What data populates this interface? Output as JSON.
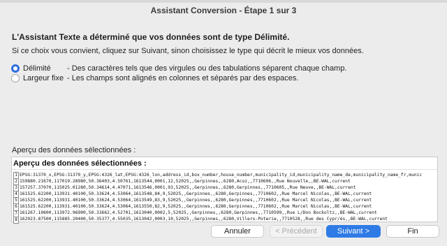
{
  "window": {
    "title": "Assistant Conversion - Étape 1 sur 3"
  },
  "main": {
    "heading": "L'Assistant Texte a déterminé que vos données sont de type Délimité.",
    "description": "Si ce choix vous convient, cliquez sur Suivant, sinon choisissez le type qui décrit le mieux vos données.",
    "options": [
      {
        "label": "Délimité",
        "description": "- Des caractères tels que des virgules ou des tabulations séparent chaque champ.",
        "selected": true
      },
      {
        "label": "Largeur fixe",
        "description": "- Les champs sont alignés en colonnes et séparés par des espaces.",
        "selected": false
      }
    ]
  },
  "preview": {
    "caption": "Aperçu des données sélectionnées :",
    "header": "Aperçu des données sélectionnées :",
    "rows": [
      {
        "num": "1",
        "text": "EPSG:31370_x,EPSG:31370_y,EPSG:4326_lat,EPSG:4326_lon,address_id,box_number,house_number,municipality_id,municipality_name_de,municipality_name_fr,munic"
      },
      {
        "num": "2",
        "text": "159880.21670,117019.28980,50.36403,4.50761,1613544,0001,12,52025,,Gerpinnes,,6280,Acoz,,7710606,,Rue Nouvelle,,BE-WAL,current"
      },
      {
        "num": "3",
        "text": "157257.37070,115025.01280,50.34614,4.47071,1613546,0001,93,52025,,Gerpinnes,,6280,Gerpinnes,,7710605,,Rue Neuve,,BE-WAL,current"
      },
      {
        "num": "4",
        "text": "161525.62200,113931.40100,50.33624,4.53064,1613548,84,9,52025,,Gerpinnes,,6280,Gerpinnes,,7710602,,Rue Marcel Nicolas,,BE-WAL,current"
      },
      {
        "num": "5",
        "text": "161525.62200,113931.40100,50.33624,4.53064,1613549,83,9,52025,,Gerpinnes,,6280,Gerpinnes,,7710602,,Rue Marcel Nicolas,,BE-WAL,current"
      },
      {
        "num": "6",
        "text": "161525.62200,113931.40100,50.33624,4.53064,1613550,82,9,52025,,Gerpinnes,,6280,Gerpinnes,,7710602,,Rue Marcel Nicolas,,BE-WAL,current"
      },
      {
        "num": "7",
        "text": "161267.10600,113972.96900,50.33662,4.52701,1613040,0002,5,52025,,Gerpinnes,,6280,Gerpinnes,,7710599,,Rue L/Don Bockoltz,,BE-WAL,current"
      },
      {
        "num": "8",
        "text": "162923.87500,115885.20400,50.35377,4.55035,1613042,0003,10,52025,,Gerpinnes,,6280,Villers-Poterie,,7710528,,Rue des Cypr/ès,,BE-WAL,current"
      }
    ]
  },
  "buttons": {
    "cancel": "Annuler",
    "previous": "< Précédent",
    "next": "Suivant >",
    "finish": "Fin"
  }
}
